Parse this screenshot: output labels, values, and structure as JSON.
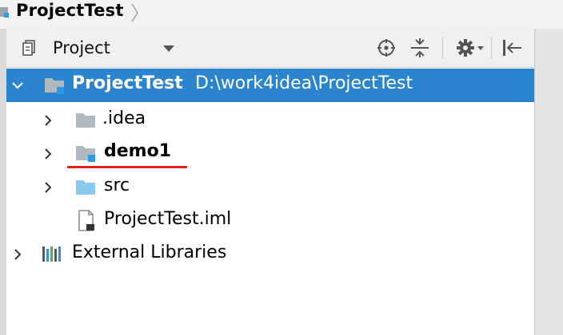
{
  "window": {
    "title": "ProjectTest"
  },
  "toolbar": {
    "view_label": "Project"
  },
  "tree": {
    "root": {
      "name": "ProjectTest",
      "path": "D:\\work4idea\\ProjectTest"
    },
    "items": [
      {
        "name": ".idea"
      },
      {
        "name": "demo1"
      },
      {
        "name": "src"
      },
      {
        "name": "ProjectTest.iml"
      }
    ],
    "external": {
      "name": "External Libraries"
    }
  },
  "colors": {
    "selection": "#2b85ce",
    "folder": "#aeb9c0",
    "source_folder": "#89c8ef",
    "module_marker": "#2b9bea",
    "annotation_underline": "#e0201b"
  },
  "icons": {
    "toolbar": [
      "project-view-icon",
      "dropdown-arrow-icon",
      "locate-icon",
      "collapse-all-icon",
      "gear-icon",
      "hide-panel-icon"
    ],
    "tree": [
      "chevron-right-icon",
      "chevron-down-icon",
      "folder-icon",
      "module-folder-icon",
      "source-folder-icon",
      "iml-file-icon",
      "library-icon"
    ]
  }
}
